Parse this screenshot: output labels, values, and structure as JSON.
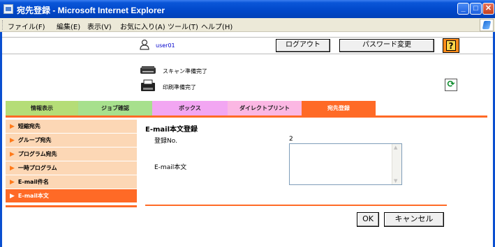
{
  "window": {
    "title": "宛先登録 - Microsoft Internet Explorer"
  },
  "menu": [
    "ファイル(F)",
    "編集(E)",
    "表示(V)",
    "お気に入り(A)",
    "ツール(T)",
    "ヘルプ(H)"
  ],
  "header": {
    "user": "user01",
    "logout": "ログアウト",
    "change_password": "パスワード変更",
    "help": "?"
  },
  "status": {
    "scan": "スキャン準備完了",
    "print": "印刷準備完了"
  },
  "tabs": [
    {
      "label": "情報表示",
      "color": "#b5dd77"
    },
    {
      "label": "ジョブ確認",
      "color": "#a7e08d"
    },
    {
      "label": "ボックス",
      "color": "#f2a6f2"
    },
    {
      "label": "ダイレクトプリント",
      "color": "#fbb7e3"
    },
    {
      "label": "宛先登録",
      "color": "#ff6a26"
    }
  ],
  "sidebar": [
    {
      "label": "短縮宛先"
    },
    {
      "label": "グループ宛先"
    },
    {
      "label": "プログラム宛先"
    },
    {
      "label": "一時プログラム"
    },
    {
      "label": "E-mail件名"
    },
    {
      "label": "E-mail本文"
    }
  ],
  "form": {
    "title": "E-mail本文登録",
    "reg_no_label": "登録No.",
    "reg_no_value": "2",
    "body_label": "E-mail本文",
    "body_value": "",
    "ok": "OK",
    "cancel": "キャンセル"
  }
}
